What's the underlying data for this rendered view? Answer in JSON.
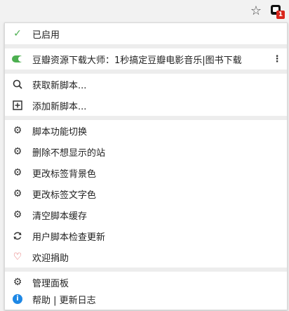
{
  "browser": {
    "extension_badge": "1",
    "star_icon": "star-outline-icon",
    "extension_icon": "tampermonkey-icon"
  },
  "menu": {
    "enabled_label": "已启用",
    "script_item_label": "豆瓣资源下载大师：1秒搞定豆瓣电影音乐|图书下载",
    "get_new_scripts_label": "获取新脚本...",
    "add_new_script_label": "添加新脚本...",
    "commands": [
      {
        "label": "脚本功能切换",
        "icon": "gear-icon"
      },
      {
        "label": "删除不想显示的站",
        "icon": "gear-icon"
      },
      {
        "label": "更改标签背景色",
        "icon": "gear-icon"
      },
      {
        "label": "更改标签文字色",
        "icon": "gear-icon"
      },
      {
        "label": "清空脚本缓存",
        "icon": "gear-icon"
      },
      {
        "label": "用户脚本检查更新",
        "icon": "refresh-icon"
      },
      {
        "label": "欢迎捐助",
        "icon": "heart-icon"
      }
    ],
    "dashboard_label": "管理面板",
    "help_label": "帮助 | 更新日志"
  },
  "colors": {
    "enabled_check": "#4caf50",
    "toggle_on": "#4caf50",
    "heart": "#e04e4e",
    "info": "#1e88e5",
    "badge": "#d9261c"
  }
}
